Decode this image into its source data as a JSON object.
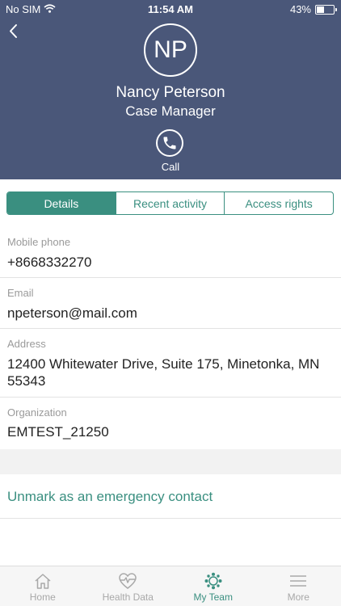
{
  "status_bar": {
    "carrier": "No SIM",
    "time": "11:54 AM",
    "battery": "43%",
    "battery_level": 0.43
  },
  "contact": {
    "initials": "NP",
    "name": "Nancy Peterson",
    "role": "Case Manager",
    "call_label": "Call"
  },
  "tabs": [
    {
      "label": "Details",
      "active": true
    },
    {
      "label": "Recent activity",
      "active": false
    },
    {
      "label": "Access rights",
      "active": false
    }
  ],
  "fields": {
    "mobile": {
      "label": "Mobile phone",
      "value": "+8668332270"
    },
    "email": {
      "label": "Email",
      "value": "npeterson@mail.com"
    },
    "address": {
      "label": "Address",
      "value": "12400 Whitewater Drive, Suite 175, Minetonka, MN 55343"
    },
    "organization": {
      "label": "Organization",
      "value": "EMTEST_21250"
    }
  },
  "action": {
    "label": "Unmark as an emergency contact"
  },
  "tabbar": [
    {
      "label": "Home",
      "icon": "home-icon"
    },
    {
      "label": "Health Data",
      "icon": "heart-pulse-icon"
    },
    {
      "label": "My Team",
      "icon": "team-icon",
      "active": true
    },
    {
      "label": "More",
      "icon": "menu-icon"
    }
  ],
  "colors": {
    "header": "#4a5779",
    "accent": "#3a8f80"
  }
}
